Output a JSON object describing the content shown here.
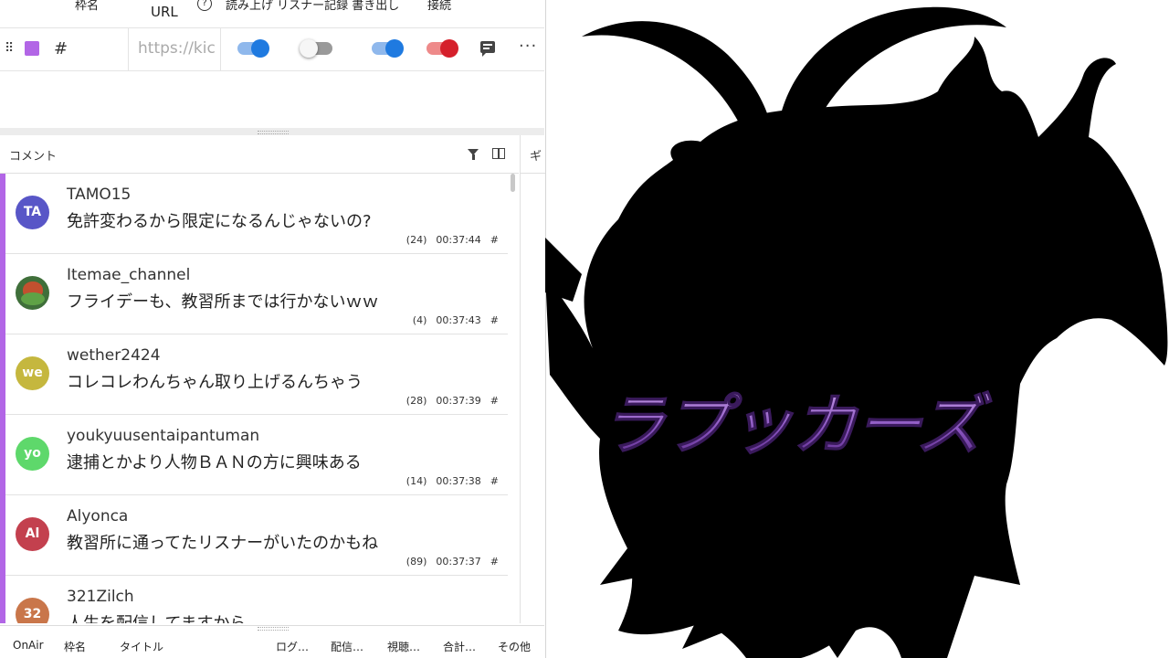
{
  "header": {
    "name_col": "枠名",
    "url_col": "URL",
    "help_icon": "?",
    "toggle_cols": "読み上げ リスナー記録 書き出し",
    "connect_col": "接続"
  },
  "stream": {
    "color": "#b266e6",
    "name": "#",
    "url": "https://kic",
    "toggles": [
      {
        "name": "read-aloud",
        "state": "on"
      },
      {
        "name": "listener-record",
        "state": "off"
      },
      {
        "name": "export",
        "state": "on"
      },
      {
        "name": "connect",
        "state": "on-red"
      }
    ]
  },
  "comments_panel": {
    "title": "コメント",
    "comments": [
      {
        "avatar": "TA",
        "avatar_color": "#5856c7",
        "user": "TAMO15",
        "text": "免許変わるから限定になるんじゃないの?",
        "count": "(24)",
        "time": "00:37:44",
        "tag": "#"
      },
      {
        "avatar": "",
        "avatar_color": "#3f6f3a",
        "user": "Itemae_channel",
        "text": "フライデーも、教習所までは行かないｗｗ",
        "count": "(4)",
        "time": "00:37:43",
        "tag": "#"
      },
      {
        "avatar": "we",
        "avatar_color": "#c5b73e",
        "user": "wether2424",
        "text": "コレコレわんちゃん取り上げるんちゃう",
        "count": "(28)",
        "time": "00:37:39",
        "tag": "#"
      },
      {
        "avatar": "yo",
        "avatar_color": "#5ed86b",
        "user": "youkyuusentaipantuman",
        "text": "逮捕とかより人物ＢＡＮの方に興味ある",
        "count": "(14)",
        "time": "00:37:38",
        "tag": "#"
      },
      {
        "avatar": "Al",
        "avatar_color": "#c3404e",
        "user": "Alyonca",
        "text": "教習所に通ってたリスナーがいたのかもね",
        "count": "(89)",
        "time": "00:37:37",
        "tag": "#"
      },
      {
        "avatar": "32",
        "avatar_color": "#c9764a",
        "user": "321Zilch",
        "text": "人生を配信してますから",
        "count": "",
        "time": "",
        "tag": ""
      }
    ]
  },
  "gift_panel": {
    "title": "ギ"
  },
  "bottom_bar": {
    "items": [
      "OnAir",
      "枠名",
      "タイトル",
      "ログ…",
      "配信…",
      "視聴…",
      "合計…",
      "その他"
    ]
  },
  "stage": {
    "logo_text": "ラプッカーズ"
  }
}
